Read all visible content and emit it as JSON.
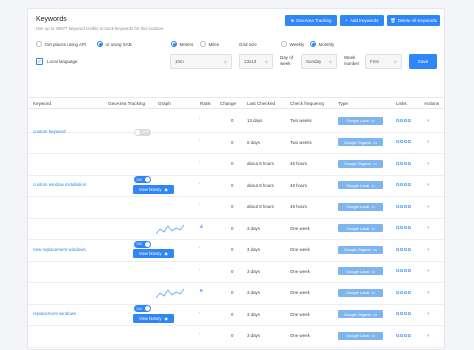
{
  "header": {
    "title": "Keywords",
    "subtitle": "Use up to 49977 keyword credits to track keywords for this location.",
    "buttons": {
      "geoarea": "GeoArea Tracking",
      "add": "Add Keywords",
      "delete_all": "Delete All Keywords"
    }
  },
  "filters": {
    "places_api": "Get places using API",
    "sab": "or using SAB",
    "meters": "Meters",
    "miles": "Miles",
    "grid_size": "Grid size",
    "weekly": "Weekly",
    "monthly": "Monthly",
    "distance_value": "10m",
    "grid_value": "13x13",
    "day_of_week_label": "Day of week",
    "day_of_week_value": "Sunday",
    "week_number_label": "Week number",
    "week_number_value": "First",
    "local_language": "Local language",
    "save": "Save"
  },
  "table": {
    "columns": [
      "Keyword",
      "GeoArea Tracking",
      "Graph",
      "Rank",
      "Change",
      "Last Checked",
      "Check frequency",
      "Type",
      "Links",
      "Actions"
    ],
    "type_google": "Google Organic",
    "type_local": "Google Local",
    "links_text": "GGGG",
    "view_history": "View history",
    "toggle_on": "ON",
    "toggle_off": "OFF",
    "groups": [
      {
        "keyword": "custom keyword",
        "tracking": "off",
        "rows": [
          {
            "rank": "-",
            "change": "0",
            "last": "13 days",
            "freq": "Two weeks",
            "type": "local"
          },
          {
            "rank": "-",
            "change": "0",
            "last": "6 days",
            "freq": "Two weeks",
            "type": "google"
          }
        ]
      },
      {
        "keyword": "custom window installation",
        "tracking": "on",
        "rows": [
          {
            "rank": "-",
            "change": "0",
            "last": "about 8 hours",
            "freq": "48 hours",
            "type": "google"
          },
          {
            "rank": "-",
            "change": "0",
            "last": "about 8 hours",
            "freq": "48 hours",
            "type": "local"
          },
          {
            "rank": "-",
            "change": "0",
            "last": "about 8 hours",
            "freq": "48 hours",
            "type": "local"
          }
        ]
      },
      {
        "keyword": "new replacement windows",
        "tracking": "on",
        "rows": [
          {
            "rank": "4",
            "change": "0",
            "last": "3 days",
            "freq": "One week",
            "type": "local"
          },
          {
            "rank": "-",
            "change": "0",
            "last": "3 days",
            "freq": "One week",
            "type": "google"
          },
          {
            "rank": "-",
            "change": "0",
            "last": "3 days",
            "freq": "One week",
            "type": "local"
          }
        ]
      },
      {
        "keyword": "replacement windows",
        "tracking": "on",
        "rows": [
          {
            "rank": "5",
            "change": "0",
            "last": "3 days",
            "freq": "One week",
            "type": "local"
          },
          {
            "rank": "-",
            "change": "0",
            "last": "3 days",
            "freq": "One week",
            "type": "google"
          },
          {
            "rank": "-",
            "change": "0",
            "last": "3 days",
            "freq": "One week",
            "type": "local"
          }
        ]
      }
    ]
  }
}
